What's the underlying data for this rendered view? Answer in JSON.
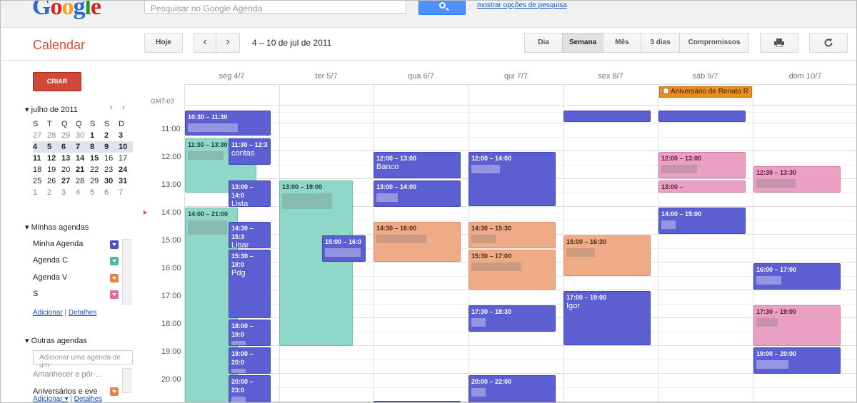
{
  "header": {
    "logo": [
      "G",
      "o",
      "o",
      "g",
      "l",
      "e"
    ],
    "logo_colors": [
      "#3366cc",
      "#dd2222",
      "#f2a31b",
      "#3366cc",
      "#199c29",
      "#dd2222"
    ],
    "search_placeholder": "Pesquisar no Google Agenda",
    "search_options_link": "mostrar opções de pesquisa"
  },
  "toolbar": {
    "app_title": "Calendar",
    "today": "Hoje",
    "prev": "‹",
    "next": "›",
    "date_range": "4 – 10 de jul de 2011",
    "views": [
      "Dia",
      "Semana",
      "Mês",
      "3 dias",
      "Compromissos"
    ],
    "active_view": "Semana",
    "print_icon": "printer-icon",
    "refresh_icon": "refresh-icon"
  },
  "sidebar": {
    "create": "CRIAR",
    "mini_title": "julho de 2011",
    "mini_head": [
      "S",
      "T",
      "Q",
      "Q",
      "S",
      "S",
      "D"
    ],
    "mini_weeks": [
      [
        "27",
        "28",
        "29",
        "30",
        "1",
        "2",
        "3"
      ],
      [
        "4",
        "5",
        "6",
        "7",
        "8",
        "9",
        "10"
      ],
      [
        "11",
        "12",
        "13",
        "14",
        "15",
        "16",
        "17"
      ],
      [
        "18",
        "19",
        "20",
        "21",
        "22",
        "23",
        "24"
      ],
      [
        "25",
        "26",
        "27",
        "28",
        "29",
        "30",
        "31"
      ],
      [
        "1",
        "2",
        "3",
        "4",
        "5",
        "6",
        "7"
      ]
    ],
    "my_cals_title": "Minhas agendas",
    "my_cals": [
      {
        "name": "Minha Agenda",
        "color": "#4c4fc4"
      },
      {
        "name": "Agenda C",
        "color": "#4fb7a4"
      },
      {
        "name": "Agenda V",
        "color": "#e9814f"
      },
      {
        "name": "S",
        "color": "#e46aa0"
      }
    ],
    "add_link": "Adicionar",
    "details_link": "Detalhes",
    "other_cals_title": "Outras agendas",
    "add_placeholder": "Adicionar uma agenda de um",
    "other_cals": [
      {
        "name": "Amanhecer e pôr-..."
      },
      {
        "name": "Aniversários e eve",
        "color": "#e9814f"
      }
    ],
    "add_link2": "Adicionar ▾",
    "details_link2": "Detalhes"
  },
  "grid": {
    "timezone": "GMT-03",
    "days": [
      "seg 4/7",
      "ter 5/7",
      "qua 6/7",
      "qui 7/7",
      "sex 8/7",
      "sáb 9/7",
      "dom 10/7"
    ],
    "hours": [
      "11:00",
      "12:00",
      "13:00",
      "14:00",
      "15:00",
      "16:00",
      "17:00",
      "18:00",
      "19:00",
      "20:00"
    ],
    "allday_event": "Aniversário de Renato R",
    "events": {
      "e1": {
        "time": "10:30 – 11:30",
        "name": ""
      },
      "e2": {
        "time": "11:30 – 13:30",
        "name": ""
      },
      "e3": {
        "time": "11:30 – 12:3",
        "name": "contas"
      },
      "e4": {
        "time": "13:00 – 14:0",
        "name": "Lista tarefas"
      },
      "e5": {
        "time": "14:00 – 21:00",
        "name": ""
      },
      "e6": {
        "time": "14:30 – 15:3",
        "name": "Ligar Claudio"
      },
      "e7": {
        "time": "15:30 – 18:0",
        "name": "Pdg"
      },
      "e8": {
        "time": "18:00 – 19:0",
        "name": ""
      },
      "e9": {
        "time": "19:00 – 20:0",
        "name": ""
      },
      "e10": {
        "time": "20:00 – 23:0",
        "name": ""
      },
      "e11": {
        "time": "13:00 – 19:00",
        "name": ""
      },
      "e12": {
        "time": "15:00 – 16:0",
        "name": ""
      },
      "e13": {
        "time": "12:00 – 13:00",
        "name": "Banco"
      },
      "e14": {
        "time": "13:00 – 14:00",
        "name": ""
      },
      "e15": {
        "time": "14:30 – 16:00",
        "name": ""
      },
      "e16": {
        "time": "12:00 – 14:00",
        "name": ""
      },
      "e17": {
        "time": "14:30 – 15:30",
        "name": ""
      },
      "e18": {
        "time": "15:30 – 17:00",
        "name": ""
      },
      "e19": {
        "time": "17:30 – 18:30",
        "name": ""
      },
      "e20": {
        "time": "20:00 – 22:00",
        "name": ""
      },
      "e21": {
        "time": "15:00 – 16:30",
        "name": ""
      },
      "e22": {
        "time": "17:00 – 19:00",
        "name": "Igor"
      },
      "e23": {
        "time": "12:00 – 13:00",
        "name": ""
      },
      "e24": {
        "time": "13:00 –",
        "name": ""
      },
      "e25": {
        "time": "14:00 – 15:00",
        "name": ""
      },
      "e26": {
        "time": "12:30 – 13:30",
        "name": ""
      },
      "e27": {
        "time": "16:00 – 17:00",
        "name": ""
      },
      "e28": {
        "time": "17:30 – 19:00",
        "name": ""
      },
      "e29": {
        "time": "19:00 – 20:00",
        "name": ""
      }
    }
  }
}
